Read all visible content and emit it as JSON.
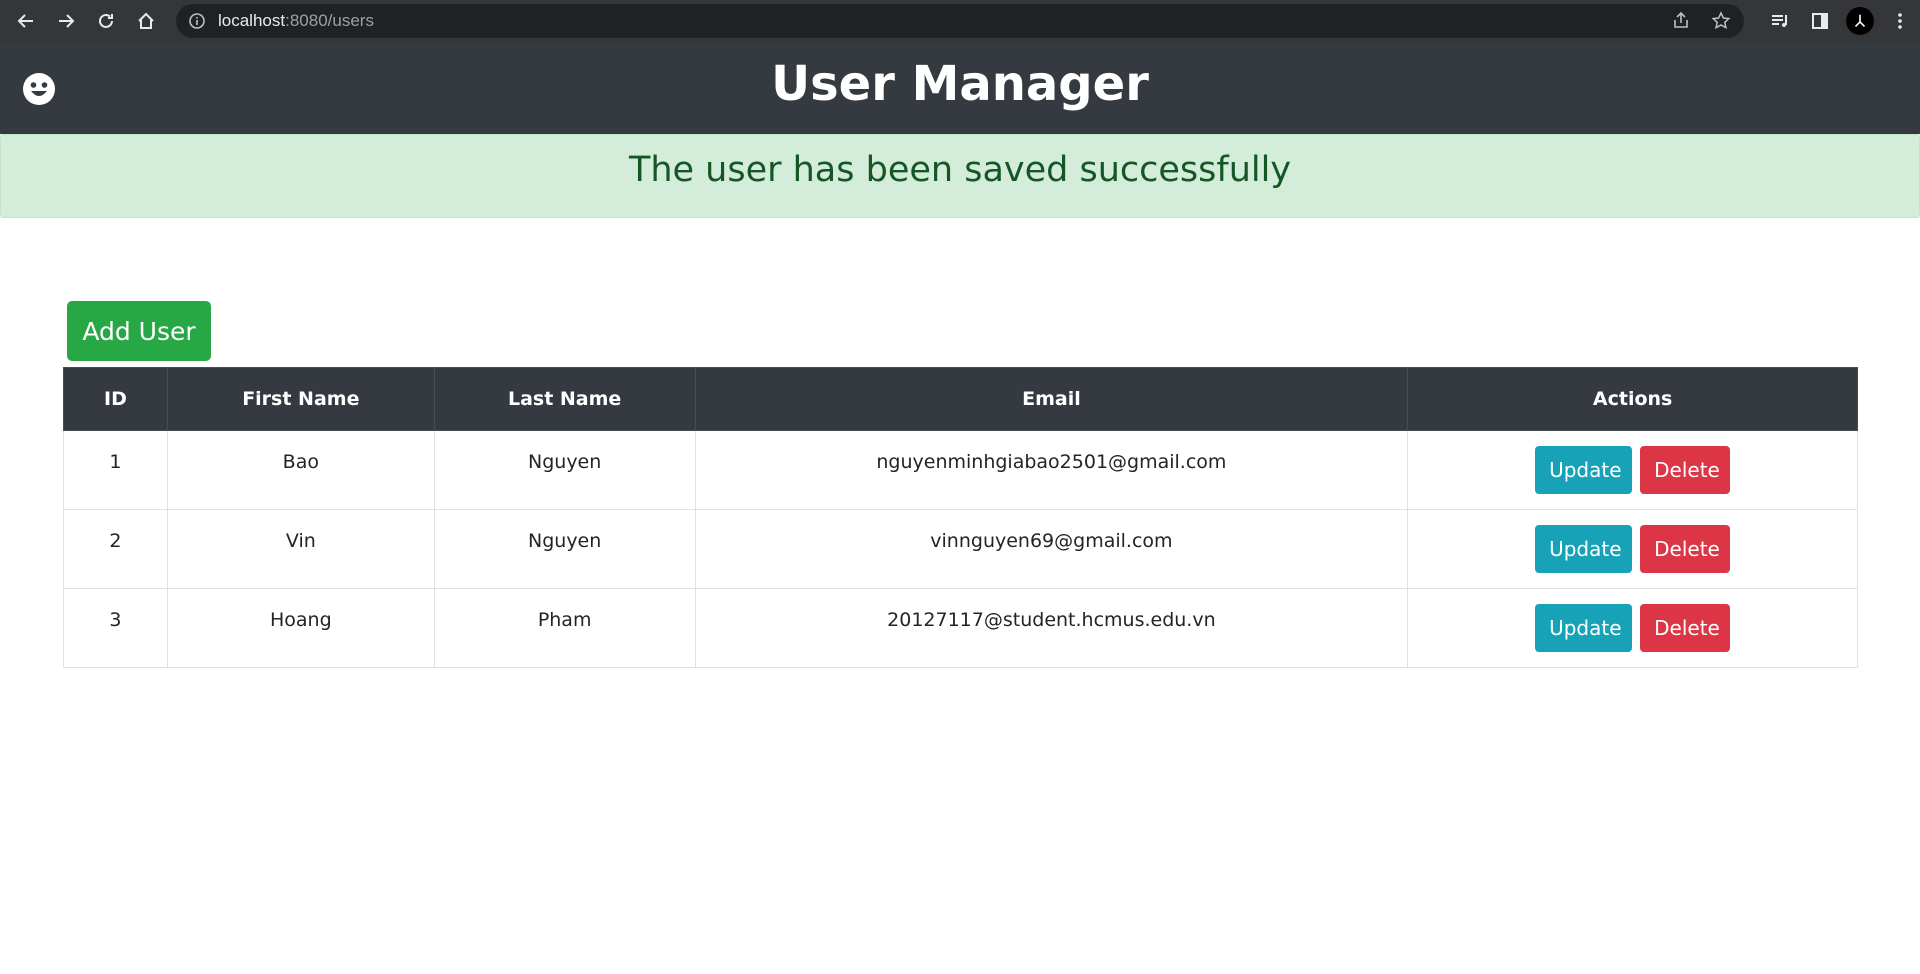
{
  "browser": {
    "url_host": "localhost",
    "url_rest": ":8080/users"
  },
  "header": {
    "title": "User Manager",
    "icon": "smiley-face-icon"
  },
  "alert": {
    "message": "The user has been saved successfully",
    "color": "#155724",
    "background": "#d4edda"
  },
  "toolbar": {
    "add_label": "Add User"
  },
  "table": {
    "headers": [
      "ID",
      "First Name",
      "Last Name",
      "Email",
      "Actions"
    ],
    "rows": [
      {
        "id": "1",
        "first_name": "Bao",
        "last_name": "Nguyen",
        "email": "nguyenminhgiabao2501@gmail.com",
        "update_label": "Update",
        "delete_label": "Delete"
      },
      {
        "id": "2",
        "first_name": "Vin",
        "last_name": "Nguyen",
        "email": "vinnguyen69@gmail.com",
        "update_label": "Update",
        "delete_label": "Delete"
      },
      {
        "id": "3",
        "first_name": "Hoang",
        "last_name": "Pham",
        "email": "20127117@student.hcmus.edu.vn",
        "update_label": "Update",
        "delete_label": "Delete"
      }
    ]
  },
  "colors": {
    "header_bg": "#343a40",
    "success": "#28a745",
    "info": "#17a2b8",
    "danger": "#dc3545"
  }
}
